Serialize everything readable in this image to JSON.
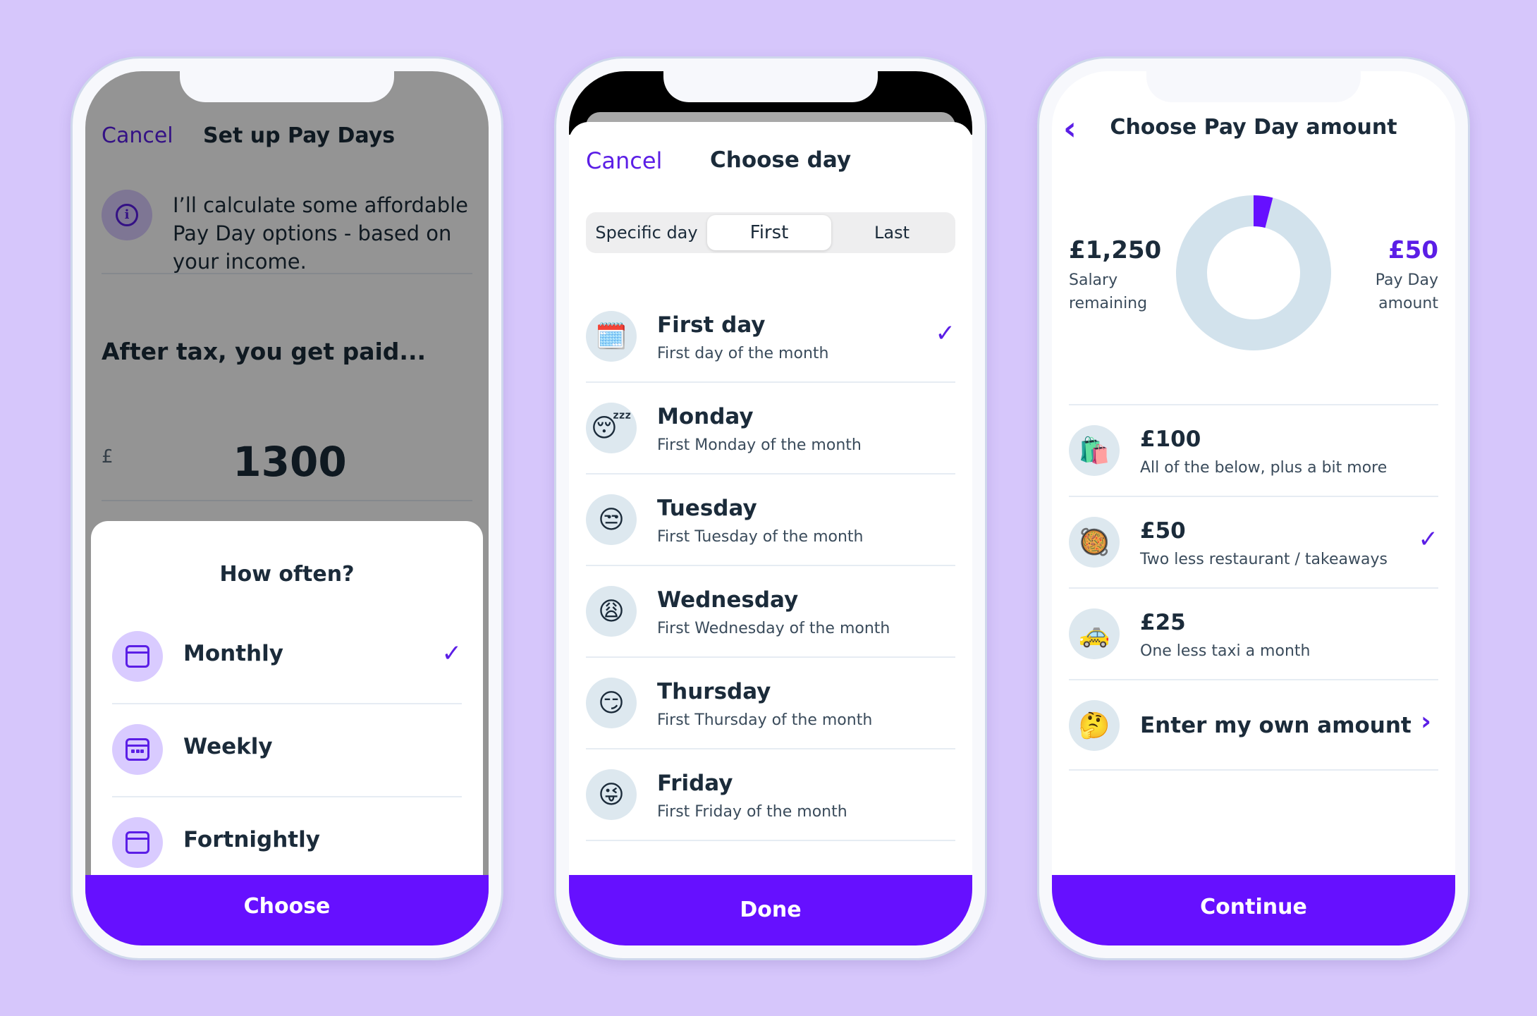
{
  "colors": {
    "background": "#d6c6fb",
    "accent": "#5b1ee6",
    "button": "#6610ff",
    "text": "#1b2b3a"
  },
  "screen1": {
    "cancel": "Cancel",
    "title": "Set up Pay Days",
    "info_icon": "info-icon",
    "info_text": "I’ll calculate some affordable Pay Day options - based on your income.",
    "heading": "After tax, you get paid...",
    "currency": "£",
    "amount": "1300",
    "sheet": {
      "title": "How often?",
      "options": [
        {
          "label": "Monthly",
          "icon": "calendar-icon",
          "selected": true
        },
        {
          "label": "Weekly",
          "icon": "calendar-dots-icon",
          "selected": false
        },
        {
          "label": "Fortnightly",
          "icon": "calendar-icon",
          "selected": false
        }
      ],
      "button": "Choose"
    }
  },
  "screen2": {
    "cancel": "Cancel",
    "title": "Choose day",
    "segments": [
      "Specific day",
      "First",
      "Last"
    ],
    "active_segment": "First",
    "days": [
      {
        "title": "First day",
        "subtitle": "First day of the month",
        "emoji": "🗓️",
        "selected": true
      },
      {
        "title": "Monday",
        "subtitle": "First Monday of the month",
        "emoji": "😴",
        "selected": false
      },
      {
        "title": "Tuesday",
        "subtitle": "First Tuesday of the month",
        "emoji": "😒",
        "selected": false
      },
      {
        "title": "Wednesday",
        "subtitle": "First Wednesday of the month",
        "emoji": "😩",
        "selected": false
      },
      {
        "title": "Thursday",
        "subtitle": "First Thursday of the month",
        "emoji": "😏",
        "selected": false
      },
      {
        "title": "Friday",
        "subtitle": "First Friday of the month",
        "emoji": "😜",
        "selected": false
      }
    ],
    "button": "Done"
  },
  "screen3": {
    "title": "Choose Pay Day amount",
    "salary_value": "£1,250",
    "salary_label_1": "Salary",
    "salary_label_2": "remaining",
    "payday_value": "£50",
    "payday_label_1": "Pay Day",
    "payday_label_2": "amount",
    "donut_fraction": 0.04,
    "options": [
      {
        "title": "£100",
        "subtitle": "All of the below, plus a bit more",
        "emoji": "🛍️",
        "selected": false
      },
      {
        "title": "£50",
        "subtitle": "Two less restaurant / takeaways",
        "emoji": "🥘",
        "selected": true
      },
      {
        "title": "£25",
        "subtitle": "One less taxi a month",
        "emoji": "🚕",
        "selected": false
      }
    ],
    "own_amount": {
      "label": "Enter my own amount",
      "emoji": "🤔"
    },
    "button": "Continue"
  }
}
